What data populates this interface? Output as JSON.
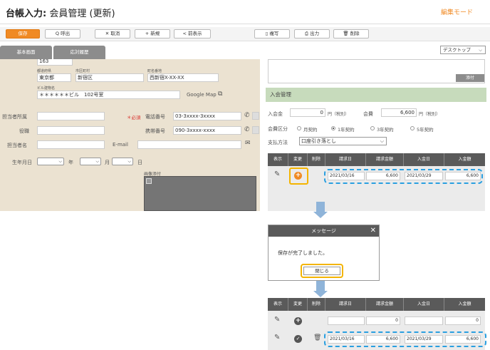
{
  "header": {
    "title_main": "台帳入力:",
    "title_sub": " 会員管理 (更新)",
    "mode": "編集モード"
  },
  "toolbar": {
    "save": "保存",
    "call": "Q 呼出",
    "cancel": "✕ 取消",
    "new": "+ 新規",
    "prev": "< 前表示",
    "copy": "▯ 複写",
    "print": "⎙ 出力",
    "delete": "🗑 削除"
  },
  "tabs": {
    "basic": "基本画面",
    "response": "応対履歴",
    "view_select": "デスクトップ"
  },
  "left": {
    "zip_value": "163",
    "pref_label": "都道府県",
    "pref_value": "東京都",
    "city_label": "市区町村",
    "city_value": "新宿区",
    "town_label": "町名番地",
    "town_value": "西新宿X-XX-XX",
    "bldg_label": "ビル建物名",
    "bldg_value": "＊＊＊＊＊＊ビル　102号室",
    "google_map": "Google Map",
    "dept_label": "担当者所属",
    "required": "＊必須",
    "tel_label": "電話番号",
    "tel_value": "03-3xxxx-3xxxx",
    "title_label": "役職",
    "mobile_label": "携帯番号",
    "mobile_value": "090-3xxxx-xxxx",
    "person_label": "担当者名",
    "email_label": "E-mail",
    "birth_label": "生年月日",
    "year": "年",
    "month": "月",
    "day": "日",
    "image_label": "画像添付"
  },
  "right": {
    "attach": "添付",
    "section": "入会管理",
    "join_fee_label": "入会金",
    "join_fee_value": "0",
    "join_fee_unit": "円（税別）",
    "annual_fee_label": "会費",
    "annual_fee_value": "6,600",
    "annual_fee_unit": "円（税別）",
    "fee_type_label": "会費区分",
    "fee_types": [
      "月契約",
      "1年契約",
      "3年契約",
      "5年契約"
    ],
    "pay_label": "支払方法",
    "pay_value": "口座引き落とし",
    "columns": [
      "表示",
      "変更",
      "削除",
      "請求日",
      "請求金額",
      "入金日",
      "入金額"
    ],
    "row": {
      "bill_date": "2021/03/16",
      "bill_amount": "6,600",
      "pay_date": "2021/03/29",
      "pay_amount": "6,600"
    }
  },
  "dialog": {
    "title": "メッセージ",
    "message": "保存が完了しました。",
    "close": "閉じる"
  },
  "bottom_grid": {
    "columns": [
      "表示",
      "変更",
      "削除",
      "請求日",
      "請求金額",
      "入金日",
      "入金額"
    ],
    "empty_row": {
      "bill_amount": "0",
      "pay_amount": "0"
    },
    "row": {
      "bill_date": "2021/03/16",
      "bill_amount": "6,600",
      "pay_date": "2021/03/29",
      "pay_amount": "6,600"
    }
  }
}
